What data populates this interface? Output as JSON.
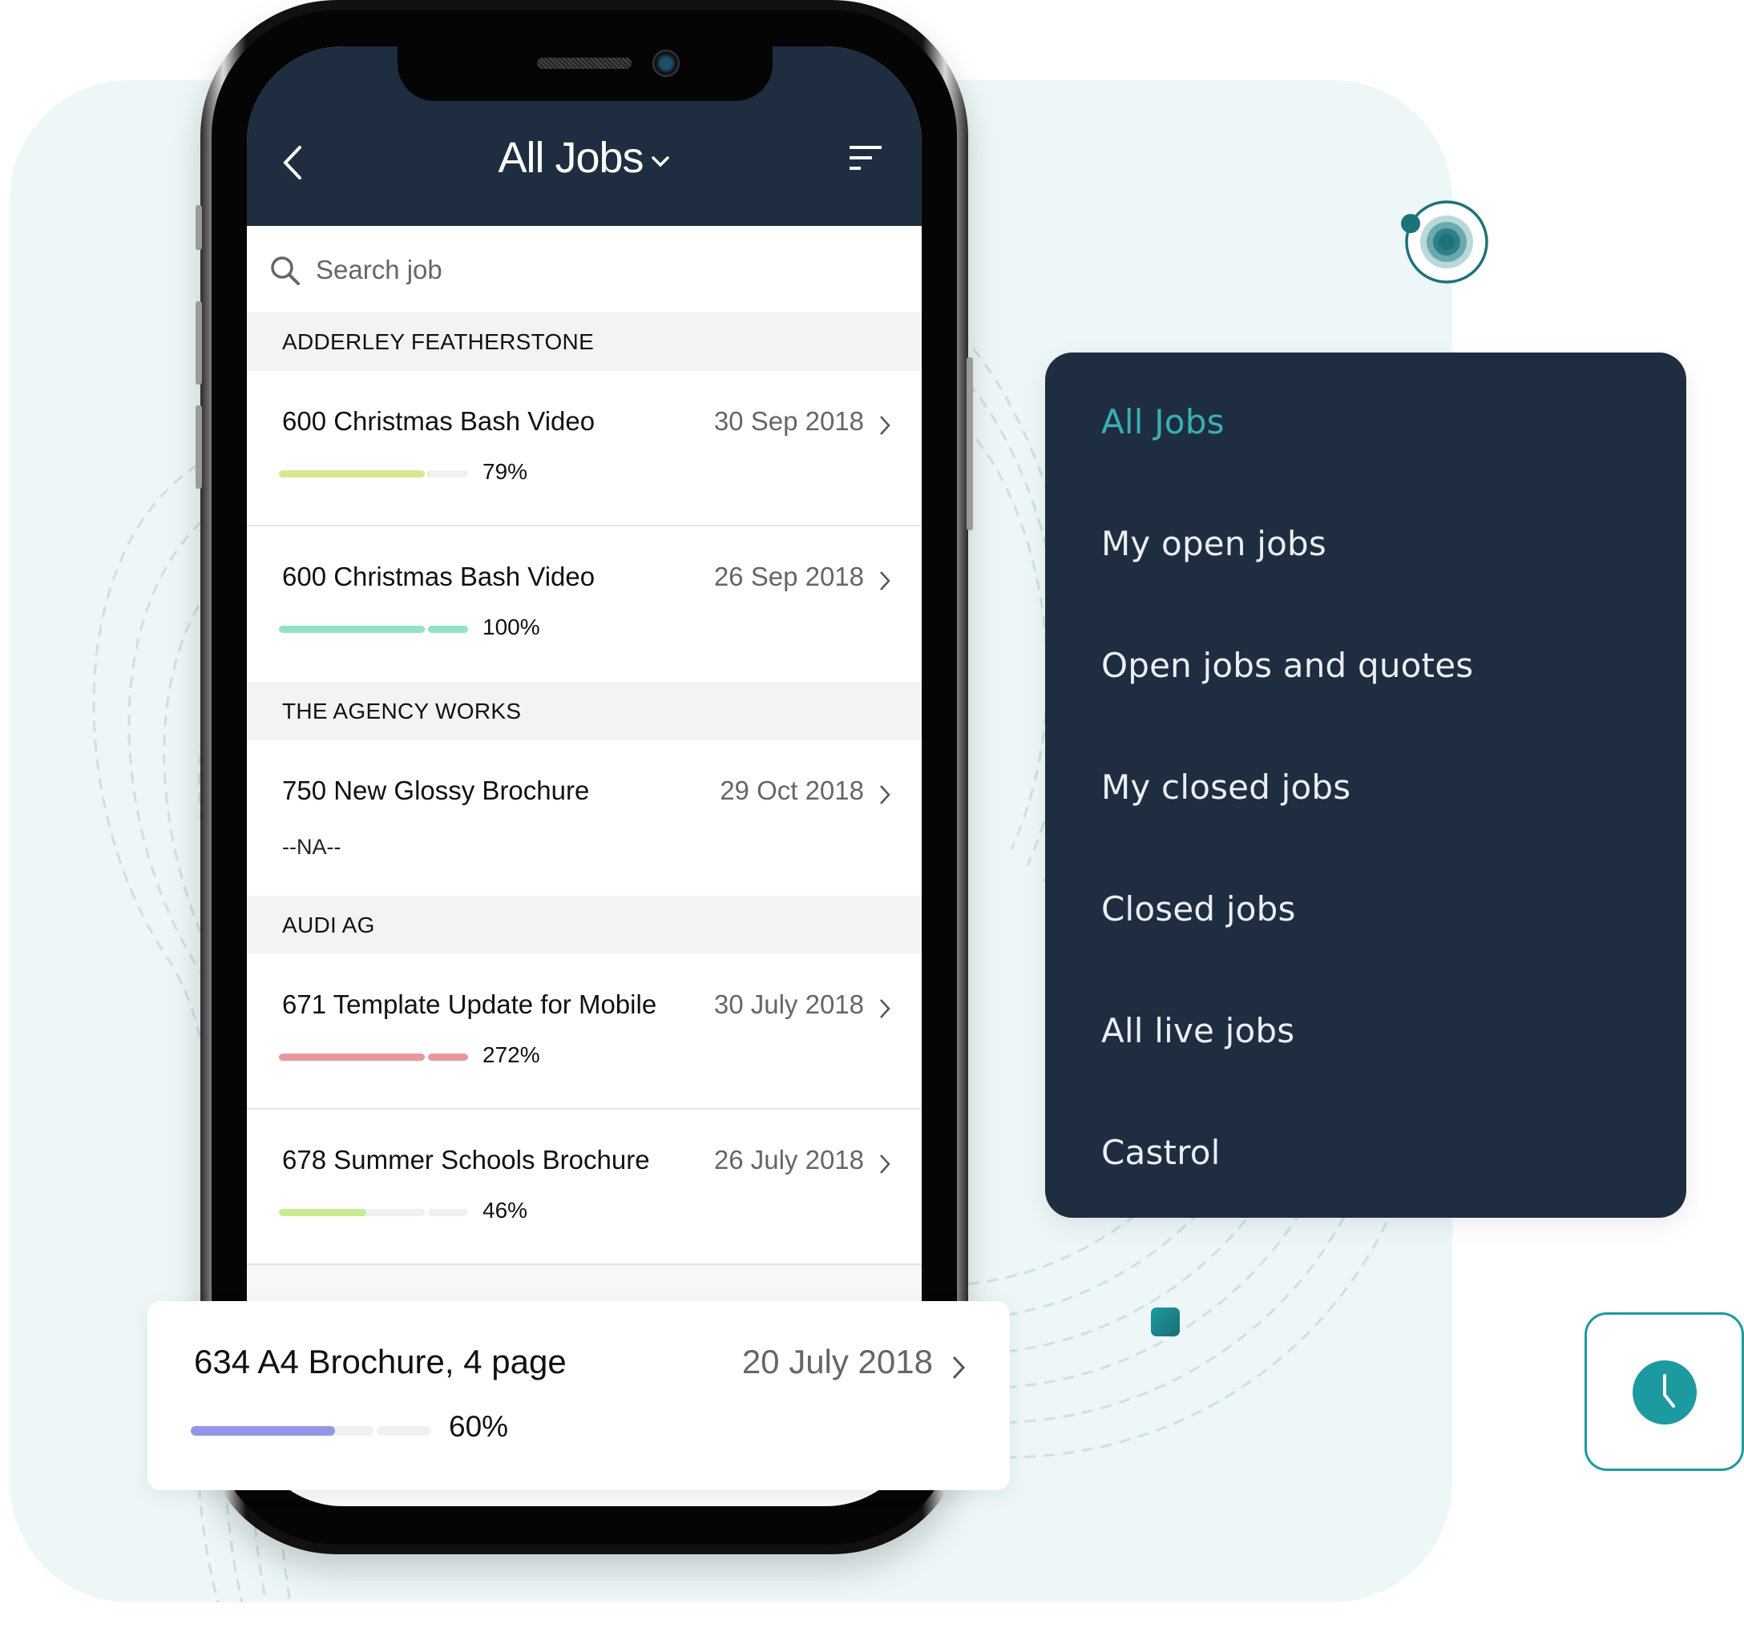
{
  "header": {
    "title": "All Jobs",
    "back_icon": "chevron-left-icon",
    "dropdown_icon": "chevron-down-icon",
    "sort_icon": "sort-icon"
  },
  "search": {
    "placeholder": "Search job",
    "value": "",
    "icon": "search-icon"
  },
  "groups": [
    {
      "client": "ADDERLEY FEATHERSTONE",
      "jobs": [
        {
          "title": "600 Christmas Bash Video",
          "date": "30 Sep 2018",
          "progress_label": "79%",
          "progress": 0.79,
          "bar_color": "#d4e88f"
        },
        {
          "title": "600 Christmas Bash Video",
          "date": "26 Sep 2018",
          "progress_label": "100%",
          "progress": 1.0,
          "bar_color": "#93e2c4"
        }
      ]
    },
    {
      "client": "THE AGENCY WORKS",
      "jobs": [
        {
          "title": "750 New Glossy Brochure",
          "date": "29 Oct 2018",
          "progress_label": "--NA--",
          "progress": null,
          "bar_color": null
        }
      ]
    },
    {
      "client": "AUDI AG",
      "jobs": [
        {
          "title": "671 Template Update for Mobile",
          "date": "30 July 2018",
          "progress_label": "272%",
          "progress": 2.72,
          "bar_color": "#e8979c"
        },
        {
          "title": "678 Summer Schools Brochure",
          "date": "26 July 2018",
          "progress_label": "46%",
          "progress": 0.46,
          "bar_color": "#c9eb92"
        }
      ]
    }
  ],
  "highlight_card": {
    "title": "634 A4 Brochure, 4 page",
    "date": "20 July 2018",
    "progress_label": "60%",
    "progress": 0.6,
    "bar_color": "#9495e6"
  },
  "filter_menu": {
    "items": [
      {
        "label": "All Jobs",
        "active": true
      },
      {
        "label": "My open jobs",
        "active": false
      },
      {
        "label": "Open jobs and quotes",
        "active": false
      },
      {
        "label": "My closed jobs",
        "active": false
      },
      {
        "label": "Closed jobs",
        "active": false
      },
      {
        "label": "All live jobs",
        "active": false
      },
      {
        "label": "Castrol",
        "active": false
      }
    ]
  },
  "decor": {
    "target_icon": "target-icon",
    "clock_icon": "clock-icon"
  },
  "colors": {
    "navy": "#1e2e40",
    "teal_accent": "#3aafb4",
    "teal_dark": "#1d7279",
    "background_tint": "#edf7f8"
  }
}
